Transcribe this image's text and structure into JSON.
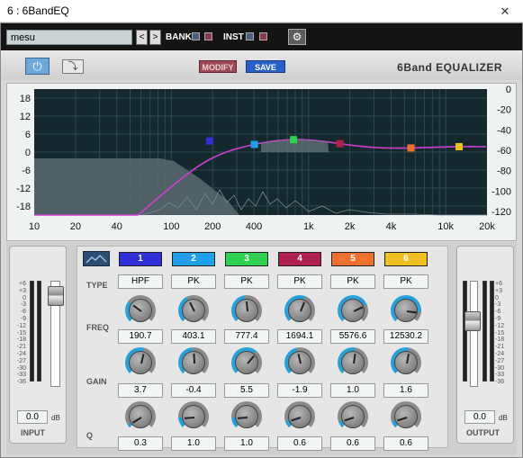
{
  "window": {
    "title": "6 : 6BandEQ",
    "close_glyph": "✕"
  },
  "toolbar": {
    "preset_value": "mesu",
    "prev_glyph": "<",
    "next_glyph": ">",
    "bank_label": "BANK",
    "inst_label": "INST",
    "bank_color_a": "#4a5e80",
    "bank_color_b": "#8a3a4a"
  },
  "header": {
    "power_glyph": "⏻",
    "bypass_glyph": "⤵",
    "modify_label": "MODIFY",
    "save_label": "SAVE",
    "title": "6Band EQUALIZER"
  },
  "graph": {
    "gain_ticks": [
      "18",
      "12",
      "6",
      "0",
      "-6",
      "-12",
      "-18"
    ],
    "level_ticks": [
      "0",
      "-20",
      "-40",
      "-60",
      "-80",
      "-100",
      "-120"
    ],
    "freq_ticks": [
      "10",
      "20",
      "40",
      "100",
      "200",
      "400",
      "1k",
      "2k",
      "4k",
      "10k",
      "20k"
    ]
  },
  "labels": {
    "type": "TYPE",
    "freq": "FREQ",
    "gain": "GAIN",
    "q": "Q"
  },
  "bands": [
    {
      "number": "1",
      "color": "#3030d8",
      "type": "HPF",
      "freq": "190.7",
      "gain": "3.7",
      "q": "0.3",
      "freq_knob": 0.3,
      "gain_knob": 0.55,
      "q_knob": 0.05
    },
    {
      "number": "2",
      "color": "#20a0e8",
      "type": "PK",
      "freq": "403.1",
      "gain": "-0.4",
      "q": "1.0",
      "freq_knob": 0.4,
      "gain_knob": 0.49,
      "q_knob": 0.15
    },
    {
      "number": "3",
      "color": "#30d050",
      "type": "PK",
      "freq": "777.4",
      "gain": "5.5",
      "q": "1.0",
      "freq_knob": 0.48,
      "gain_knob": 0.65,
      "q_knob": 0.15
    },
    {
      "number": "4",
      "color": "#b02050",
      "type": "PK",
      "freq": "1694.1",
      "gain": "-1.9",
      "q": "0.6",
      "freq_knob": 0.58,
      "gain_knob": 0.45,
      "q_knob": 0.1
    },
    {
      "number": "5",
      "color": "#f07030",
      "type": "PK",
      "freq": "5576.6",
      "gain": "1.0",
      "q": "0.6",
      "freq_knob": 0.74,
      "gain_knob": 0.53,
      "q_knob": 0.1
    },
    {
      "number": "6",
      "color": "#f0c020",
      "type": "PK",
      "freq": "12530.2",
      "gain": "1.6",
      "q": "0.6",
      "freq_knob": 0.86,
      "gain_knob": 0.54,
      "q_knob": 0.1
    }
  ],
  "input": {
    "label": "INPUT",
    "value": "0.0",
    "unit": "dB"
  },
  "output": {
    "label": "OUTPUT",
    "value": "0.0",
    "unit": "dB"
  },
  "meter_scale": [
    "+6",
    "+3",
    "0",
    "-3",
    "-6",
    "-9",
    "-12",
    "-15",
    "-18",
    "-21",
    "-24",
    "-27",
    "-30",
    "-33",
    "-36"
  ]
}
